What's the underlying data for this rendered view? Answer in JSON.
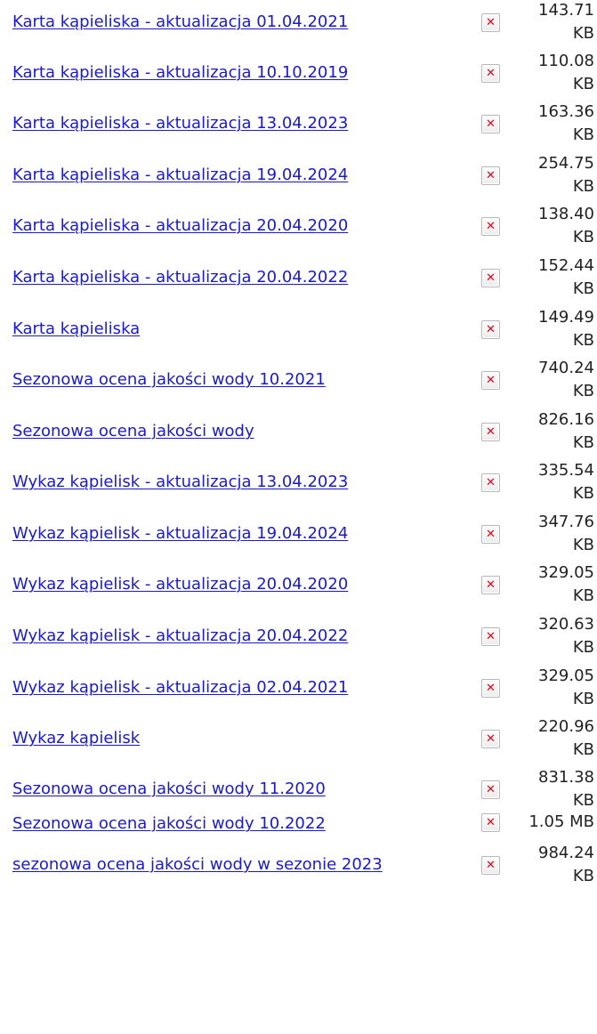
{
  "files": [
    {
      "title": "Karta kąpieliska - aktualizacja 01.04.2021",
      "size": "143.71\nKB",
      "icon": "broken-image-icon"
    },
    {
      "title": "Karta kąpieliska - aktualizacja 10.10.2019",
      "size": "110.08\nKB",
      "icon": "broken-image-icon"
    },
    {
      "title": "Karta kąpieliska - aktualizacja 13.04.2023",
      "size": "163.36\nKB",
      "icon": "broken-image-icon"
    },
    {
      "title": "Karta kąpieliska - aktualizacja 19.04.2024",
      "size": "254.75\nKB",
      "icon": "broken-image-icon"
    },
    {
      "title": "Karta kąpieliska - aktualizacja 20.04.2020",
      "size": "138.40\nKB",
      "icon": "broken-image-icon"
    },
    {
      "title": "Karta kąpieliska - aktualizacja 20.04.2022",
      "size": "152.44\nKB",
      "icon": "broken-image-icon"
    },
    {
      "title": "Karta kąpieliska",
      "size": "149.49\nKB",
      "icon": "broken-image-icon"
    },
    {
      "title": "Sezonowa ocena jakości wody 10.2021",
      "size": "740.24\nKB",
      "icon": "broken-image-icon"
    },
    {
      "title": "Sezonowa ocena jakości wody",
      "size": "826.16\nKB",
      "icon": "broken-image-icon"
    },
    {
      "title": "Wykaz kąpielisk - aktualizacja 13.04.2023",
      "size": "335.54\nKB",
      "icon": "broken-image-icon"
    },
    {
      "title": "Wykaz kąpielisk - aktualizacja 19.04.2024",
      "size": "347.76\nKB",
      "icon": "broken-image-icon"
    },
    {
      "title": "Wykaz kąpielisk - aktualizacja 20.04.2020",
      "size": "329.05\nKB",
      "icon": "broken-image-icon"
    },
    {
      "title": "Wykaz kąpielisk - aktualizacja 20.04.2022",
      "size": "320.63\nKB",
      "icon": "broken-image-icon"
    },
    {
      "title": "Wykaz kąpielisk - aktualizacja 02.04.2021",
      "size": "329.05\nKB",
      "icon": "broken-image-icon"
    },
    {
      "title": "Wykaz kąpielisk",
      "size": "220.96\nKB",
      "icon": "broken-image-icon"
    },
    {
      "title": "Sezonowa ocena jakości wody 11.2020",
      "size": "831.38\nKB",
      "icon": "broken-image-icon"
    },
    {
      "title": "Sezonowa ocena jakości wody 10.2022",
      "size": "1.05 MB",
      "icon": "broken-image-icon"
    },
    {
      "title": "sezonowa ocena jakości wody w sezonie 2023 ",
      "size": "984.24\nKB",
      "icon": "broken-image-icon"
    }
  ],
  "colors": {
    "link": "#1a1acc",
    "icon_mark": "#d8091e",
    "text": "#222222"
  }
}
